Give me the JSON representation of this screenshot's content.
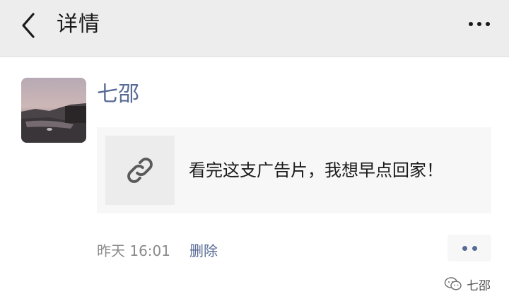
{
  "header": {
    "title": "详情",
    "back_icon": "chevron-left-icon",
    "more_icon": "more-horizontal-icon"
  },
  "post": {
    "username": "七邵",
    "link_title": "看完这支广告片，我想早点回家！",
    "link_icon": "link-icon",
    "time": "昨天 16:01",
    "delete_label": "删除",
    "action_icon": "more-dots-icon"
  },
  "watermark": {
    "text": "七邵",
    "icon": "wechat-icon"
  },
  "colors": {
    "topbar": "#ededed",
    "name_link": "#576b95",
    "muted": "#8a8a8a",
    "card": "#f7f7f7"
  }
}
